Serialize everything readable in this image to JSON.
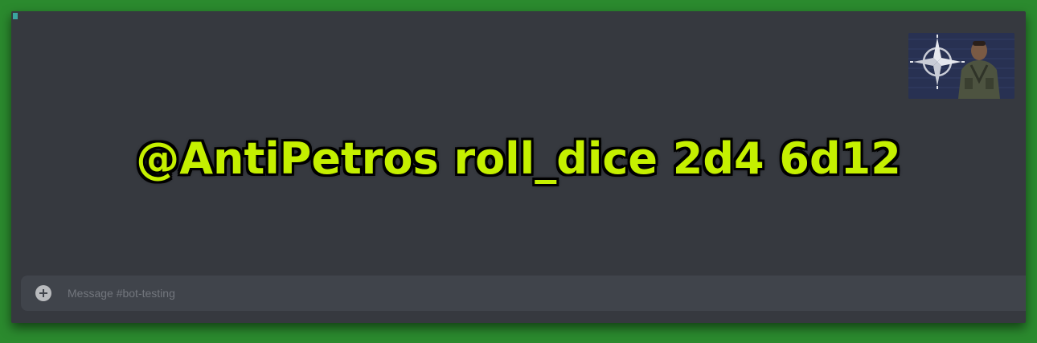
{
  "overlay": {
    "command": "@AntiPetros roll_dice 2d4 6d12",
    "color": "#c5f000"
  },
  "composer": {
    "placeholder": "Message #bot-testing",
    "value": "",
    "add_icon": "plus-circle-icon"
  },
  "video_thumbnail": {
    "emblem_icon": "compass-star-icon"
  },
  "colors": {
    "background": "#2b8a2e",
    "panel": "#36393f",
    "composer": "#40444b"
  }
}
